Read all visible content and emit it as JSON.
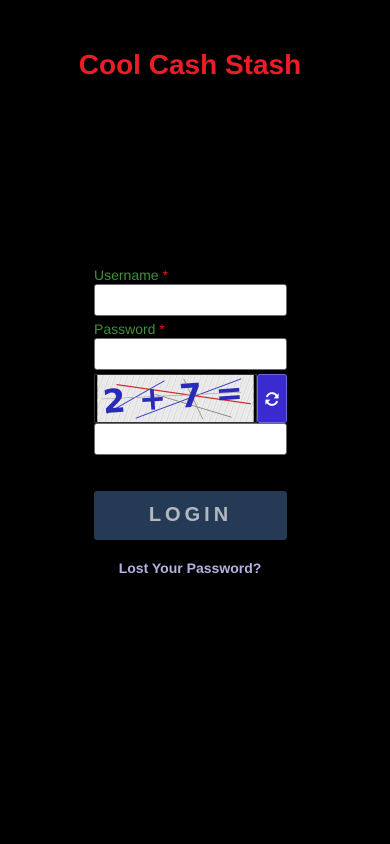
{
  "app": {
    "title": "Cool Cash Stash"
  },
  "form": {
    "username_label": "Username",
    "password_label": "Password",
    "required_marker": "*",
    "username_value": "",
    "password_value": "",
    "captcha_value": "",
    "captcha_text": "2+7=",
    "login_label": "LOGIN",
    "lost_password_label": "Lost Your Password?"
  },
  "icons": {
    "captcha_refresh": "refresh-icon"
  },
  "colors": {
    "background": "#000000",
    "title": "#ee1c25",
    "label": "#3e8e3e",
    "required": "#e01e1e",
    "login_button_bg": "#243a55",
    "login_button_text": "#b3b8c0",
    "refresh_button_bg": "#3a2bd0",
    "link": "#b1b2df"
  }
}
